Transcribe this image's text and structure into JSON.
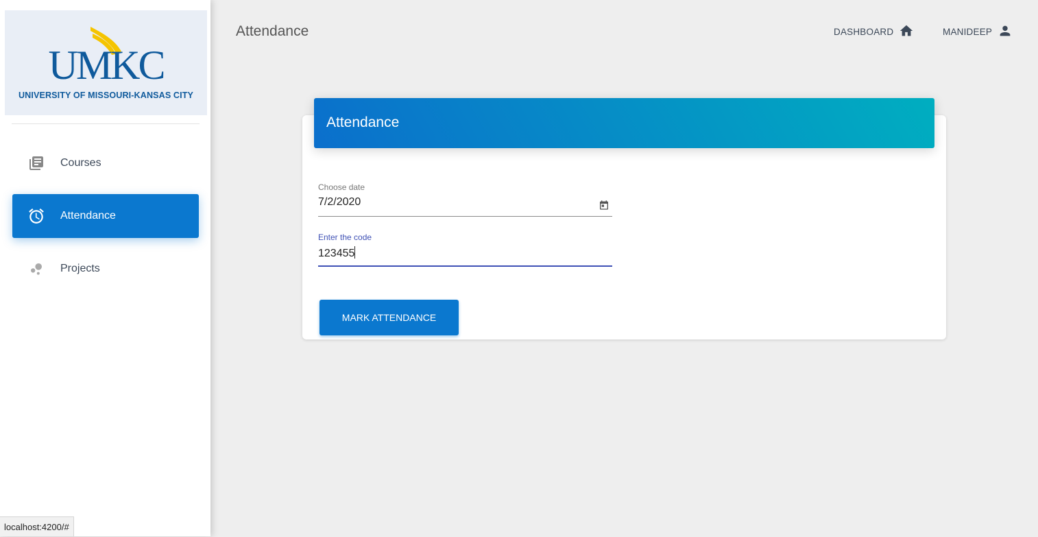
{
  "sidebar": {
    "logo": {
      "wordmark": "UMKC",
      "subtitle": "UNIVERSITY OF MISSOURI-KANSAS CITY",
      "brand_blue": "#0f5a9c",
      "brand_gold": "#f5c400"
    },
    "items": [
      {
        "label": "Courses",
        "icon": "library-books-icon",
        "active": false
      },
      {
        "label": "Attendance",
        "icon": "alarm-icon",
        "active": true
      },
      {
        "label": "Projects",
        "icon": "bubble-chart-icon",
        "active": false
      }
    ],
    "active_color": "#0b78cf"
  },
  "header": {
    "title": "Attendance",
    "dashboard_label": "DASHBOARD",
    "dashboard_icon": "home-icon",
    "user_label": "MANIDEEP",
    "user_icon": "person-icon"
  },
  "card": {
    "title": "Attendance",
    "gradient": [
      "#0b6fcc",
      "#00aec0"
    ],
    "date_field": {
      "label": "Choose date",
      "value": "7/2/2020",
      "icon": "calendar-icon"
    },
    "code_field": {
      "label": "Enter the code",
      "value": "123455"
    },
    "submit_label": "MARK ATTENDANCE"
  },
  "status_bar": {
    "url": "localhost:4200/#"
  }
}
